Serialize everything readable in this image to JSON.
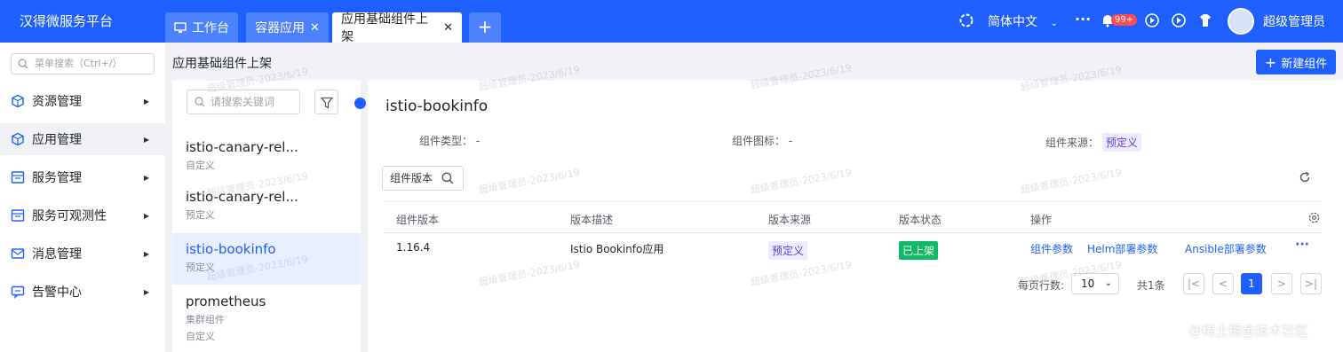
{
  "app": {
    "title": "汉得微服务平台"
  },
  "tabs": [
    {
      "label": "工作台",
      "closable": false
    },
    {
      "label": "容器应用",
      "closable": true
    },
    {
      "label": "应用基础组件上架",
      "closable": true,
      "active": true
    }
  ],
  "tab_add": "+",
  "header": {
    "language": "简体中文",
    "more": "···",
    "notification_badge": "99+",
    "user_name": "超级管理员"
  },
  "sidebar": {
    "search_placeholder": "菜单搜索（Ctrl+/）",
    "items": [
      {
        "label": "资源管理",
        "icon": "cube-icon"
      },
      {
        "label": "应用管理",
        "icon": "cube-icon"
      },
      {
        "label": "服务管理",
        "icon": "service-icon"
      },
      {
        "label": "服务可观测性",
        "icon": "service-icon"
      },
      {
        "label": "消息管理",
        "icon": "message-icon"
      },
      {
        "label": "告警中心",
        "icon": "alarm-icon"
      }
    ]
  },
  "page": {
    "title": "应用基础组件上架",
    "new_button": "新建组件"
  },
  "component_list": {
    "search_placeholder": "请搜索关键词",
    "items": [
      {
        "name": "istio-canary-rel...",
        "sub": [
          "自定义"
        ]
      },
      {
        "name": "istio-canary-rel...",
        "sub": [
          "预定义"
        ]
      },
      {
        "name": "istio-bookinfo",
        "sub": [
          "预定义"
        ],
        "selected": true
      },
      {
        "name": "prometheus",
        "sub": [
          "集群组件",
          "自定义"
        ]
      }
    ]
  },
  "detail": {
    "title": "istio-bookinfo",
    "meta": {
      "type_label": "组件类型：",
      "type_value": "-",
      "icon_label": "组件图标：",
      "icon_value": "-",
      "source_label": "组件来源：",
      "source_value": "预定义"
    },
    "version_search_placeholder": "组件版本",
    "table": {
      "columns": [
        "组件版本",
        "版本描述",
        "版本来源",
        "版本状态",
        "操作"
      ],
      "rows": [
        {
          "version": "1.16.4",
          "description": "Istio Bookinfo应用",
          "source": "预定义",
          "status": "已上架",
          "actions": [
            "组件参数",
            "Helm部署参数",
            "Ansible部署参数"
          ],
          "more": "···"
        }
      ]
    },
    "pagination": {
      "page_size_label": "每页行数:",
      "page_size": "10",
      "total": "共1条",
      "current_page": "1"
    }
  },
  "watermark": "超级管理员-2023/6/19",
  "footer_watermark": "@稀土掘金技术社区",
  "colors": {
    "primary": "#1f5fff",
    "success": "#12b76a",
    "tag_purple": "#5b3fd6"
  }
}
